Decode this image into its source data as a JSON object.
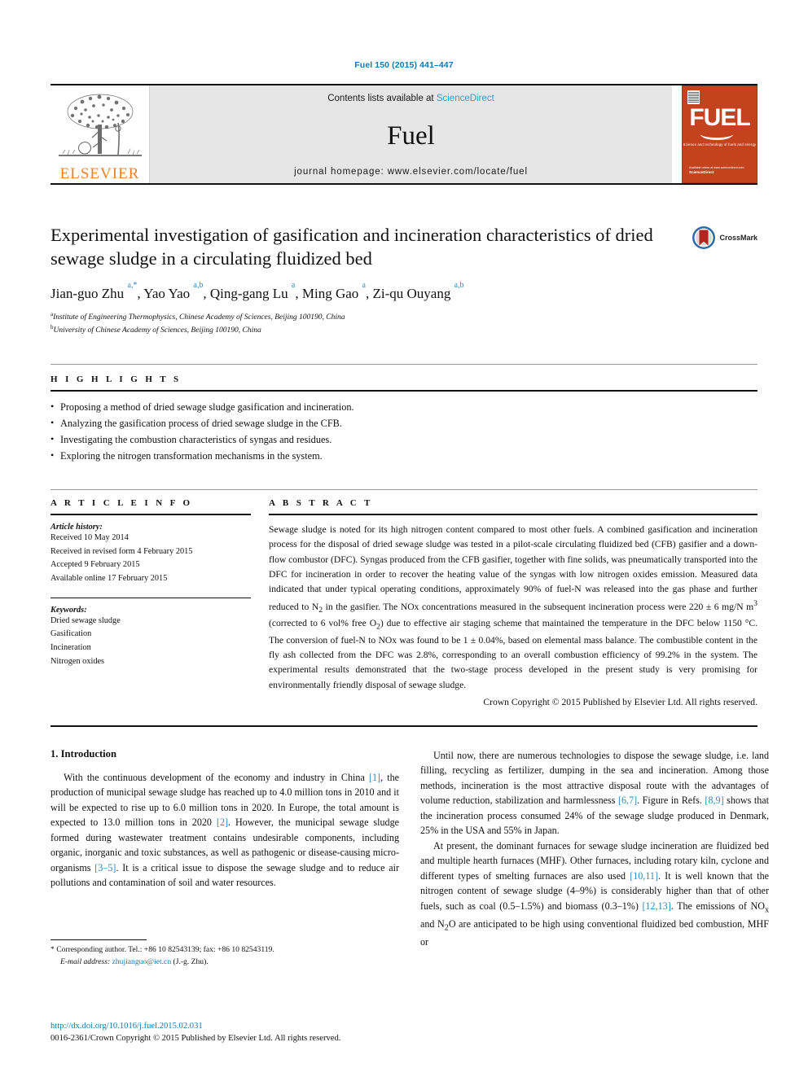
{
  "running_head": "Fuel 150 (2015) 441–447",
  "masthead": {
    "publisher_name": "ELSEVIER",
    "publisher_logo_icon": "elsevier-tree-icon",
    "contents_prefix": "Contents lists available at ",
    "contents_link": "ScienceDirect",
    "journal_title": "Fuel",
    "homepage_text": "journal homepage: www.elsevier.com/locate/fuel",
    "cover": {
      "wordmark": "FUEL",
      "subtitle": "Science and technology of fuels and energy",
      "footer_line1": "Available online at www.sciencedirect.com",
      "footer_line2": "ScienceDirect"
    }
  },
  "article": {
    "title": "Experimental investigation of gasification and incineration characteristics of dried sewage sludge in a circulating fluidized bed",
    "crossmark_label": "CrossMark",
    "crossmark_icon": "crossmark-icon",
    "authors_html": "Jian-guo Zhu <sup>a,*</sup>, Yao Yao <sup>a,b</sup>, Qing-gang Lu <sup>a</sup>, Ming Gao <sup>a</sup>, Zi-qu Ouyang <sup>a,b</sup>",
    "affiliations": [
      {
        "marker": "a",
        "text": "Institute of Engineering Thermophysics, Chinese Academy of Sciences, Beijing 100190, China"
      },
      {
        "marker": "b",
        "text": "University of Chinese Academy of Sciences, Beijing 100190, China"
      }
    ]
  },
  "highlights": {
    "heading": "H I G H L I G H T S",
    "items": [
      "Proposing a method of dried sewage sludge gasification and incineration.",
      "Analyzing the gasification process of dried sewage sludge in the CFB.",
      "Investigating the combustion characteristics of syngas and residues.",
      "Exploring the nitrogen transformation mechanisms in the system."
    ]
  },
  "article_info": {
    "heading": "A R T I C L E  I N F O",
    "history_heading": "Article history:",
    "history": [
      "Received 10 May 2014",
      "Received in revised form 4 February 2015",
      "Accepted 9 February 2015",
      "Available online 17 February 2015"
    ],
    "keywords_heading": "Keywords:",
    "keywords": [
      "Dried sewage sludge",
      "Gasification",
      "Incineration",
      "Nitrogen oxides"
    ]
  },
  "abstract": {
    "heading": "A B S T R A C T",
    "body_html": "Sewage sludge is noted for its high nitrogen content compared to most other fuels. A combined gasification and incineration process for the disposal of dried sewage sludge was tested in a pilot-scale circulating fluidized bed (CFB) gasifier and a down-flow combustor (DFC). Syngas produced from the CFB gasifier, together with fine solids, was pneumatically transported into the DFC for incineration in order to recover the heating value of the syngas with low nitrogen oxides emission. Measured data indicated that under typical operating conditions, approximately 90% of fuel-N was released into the gas phase and further reduced to N<sub>2</sub> in the gasifier. The NOx concentrations measured in the subsequent incineration process were 220 ± 6 mg/N m<sup>3</sup> (corrected to 6 vol% free O<sub>2</sub>) due to effective air staging scheme that maintained the temperature in the DFC below 1150 °C. The conversion of fuel-N to NOx was found to be 1 ± 0.04%, based on elemental mass balance. The combustible content in the fly ash collected from the DFC was 2.8%, corresponding to an overall combustion efficiency of 99.2% in the system. The experimental results demonstrated that the two-stage process developed in the present study is very promising for environmentally friendly disposal of sewage sludge.",
    "copyright": "Crown Copyright © 2015 Published by Elsevier Ltd. All rights reserved."
  },
  "introduction": {
    "section_number_title": "1. Introduction",
    "left_paragraphs_html": [
      "With the continuous development of the economy and industry in China <span class=\"ref\">[1]</span>, the production of municipal sewage sludge has reached up to 4.0 million tons in 2010 and it will be expected to rise up to 6.0 million tons in 2020. In Europe, the total amount is expected to 13.0 million tons in 2020 <span class=\"ref\">[2]</span>. However, the municipal sewage sludge formed during wastewater treatment contains undesirable components, including organic, inorganic and toxic substances, as well as pathogenic or disease-causing micro-organisms <span class=\"ref\">[3–5]</span>. It is a critical issue to dispose the sewage sludge and to reduce air pollutions and contamination of soil and water resources."
    ],
    "right_paragraphs_html": [
      "Until now, there are numerous technologies to dispose the sewage sludge, i.e. land filling, recycling as fertilizer, dumping in the sea and incineration. Among those methods, incineration is the most attractive disposal route with the advantages of volume reduction, stabilization and harmlessness <span class=\"ref\">[6,7]</span>. Figure in Refs. <span class=\"ref\">[8,9]</span> shows that the incineration process consumed 24% of the sewage sludge produced in Denmark, 25% in the USA and 55% in Japan.",
      "At present, the dominant furnaces for sewage sludge incineration are fluidized bed and multiple hearth furnaces (MHF). Other furnaces, including rotary kiln, cyclone and different types of smelting furnaces are also used <span class=\"ref\">[10,11]</span>. It is well known that the nitrogen content of sewage sludge (4–9%) is considerably higher than that of other fuels, such as coal (0.5–1.5%) and biomass (0.3–1%) <span class=\"ref\">[12,13]</span>. The emissions of NO<sub>x</sub> and N<sub>2</sub>O are anticipated to be high using conventional fluidized bed combustion, MHF or"
    ]
  },
  "footnote": {
    "corresponding_html": "* Corresponding author. Tel.: +86 10 82543139; fax: +86 10 82543119.",
    "email_label": "E-mail address:",
    "email": "zhujianguo@iet.cn",
    "email_suffix": "(J.-g. Zhu)."
  },
  "bottom": {
    "doi": "http://dx.doi.org/10.1016/j.fuel.2015.02.031",
    "issn_line": "0016-2361/Crown Copyright © 2015 Published by Elsevier Ltd. All rights reserved."
  },
  "colors": {
    "link_blue": "#1577ad",
    "ref_blue": "#2a8cbf",
    "running_head_blue": "#0b7bb5",
    "elsevier_orange": "#f57f20",
    "cover_orange": "#c4421d",
    "band_grey": "#e6e6e6"
  }
}
